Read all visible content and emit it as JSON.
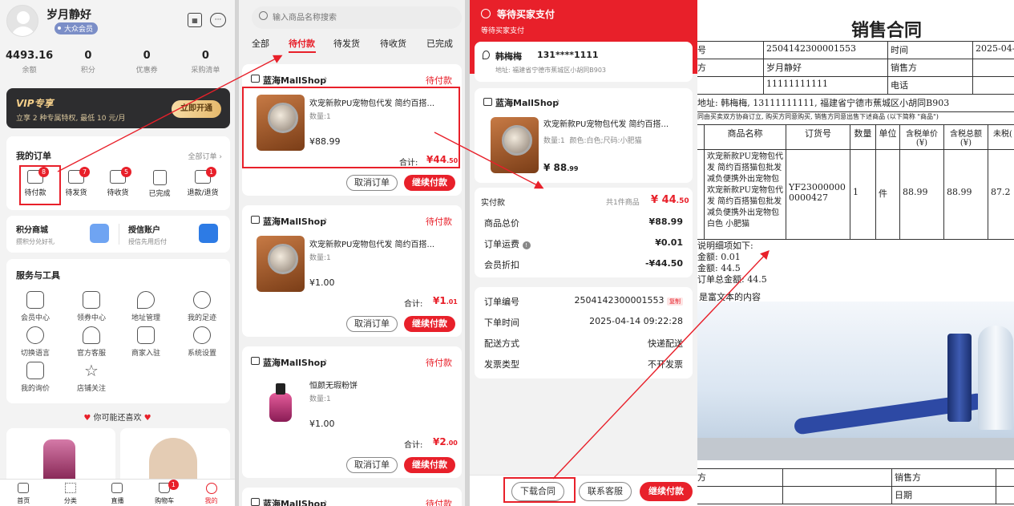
{
  "profile": {
    "name": "岁月静好",
    "member": "大众会员",
    "stats": [
      {
        "value": "4493.16",
        "label": "余额"
      },
      {
        "value": "0",
        "label": "积分"
      },
      {
        "value": "0",
        "label": "优惠券"
      },
      {
        "value": "0",
        "label": "采购清单"
      }
    ]
  },
  "vip": {
    "logo": "VIP专享",
    "desc": "立享 2 种专属特权, 最低 10 元/月",
    "cta": "立即开通"
  },
  "orders": {
    "title": "我的订单",
    "all": "全部订单",
    "items": [
      {
        "label": "待付款",
        "badge": "8"
      },
      {
        "label": "待发货",
        "badge": "7"
      },
      {
        "label": "待收货",
        "badge": "5"
      },
      {
        "label": "已完成",
        "badge": ""
      },
      {
        "label": "退款/退货",
        "badge": "1"
      }
    ]
  },
  "promo": {
    "mall_title": "积分商城",
    "mall_sub": "攒积分兑好礼",
    "credit_title": "授信账户",
    "credit_sub": "授信先用后付"
  },
  "tools": {
    "title": "服务与工具",
    "items": [
      "会员中心",
      "领券中心",
      "地址管理",
      "我的足迹",
      "切换语言",
      "官方客服",
      "商家入驻",
      "系统设置",
      "我的询价",
      "店铺关注"
    ]
  },
  "recommend": "你可能还喜欢",
  "bottom_nav": [
    {
      "label": "首页"
    },
    {
      "label": "分类"
    },
    {
      "label": "直播"
    },
    {
      "label": "购物车",
      "badge": "1"
    },
    {
      "label": "我的"
    }
  ],
  "order_list": {
    "search_placeholder": "输入商品名称搜索",
    "tabs": [
      "全部",
      "待付款",
      "待发货",
      "待收货",
      "已完成"
    ],
    "orders": [
      {
        "shop": "蓝海MallShop",
        "status": "待付款",
        "title": "欢宠新款PU宠物包代发 简约百搭...",
        "qty": "数量:1",
        "price": "¥88.99",
        "total_label": "合计:",
        "total_int": "¥44",
        "total_dec": ".50"
      },
      {
        "shop": "蓝海MallShop",
        "status": "待付款",
        "title": "欢宠新款PU宠物包代发 简约百搭...",
        "qty": "数量:1",
        "price": "¥1.00",
        "total_label": "合计:",
        "total_int": "¥1",
        "total_dec": ".01"
      },
      {
        "shop": "蓝海MallShop",
        "status": "待付款",
        "title": "恒颜无瑕粉饼",
        "qty": "数量:1",
        "price": "¥1.00",
        "total_label": "合计:",
        "total_int": "¥2",
        "total_dec": ".00"
      },
      {
        "shop": "蓝海MallShop",
        "status": "待付款"
      }
    ],
    "cancel": "取消订单",
    "pay": "继续付款"
  },
  "detail": {
    "title": "等待买家支付",
    "sub": "等待买家支付",
    "name": "韩梅梅",
    "phone": "131****1111",
    "address": "地址: 福建省宁德市蕉城区小胡同B903",
    "shop": "蓝海MallShop",
    "product": "欢宠新款PU宠物包代发 简约百搭...",
    "spec": "数量:1  颜色:白色;尺码:小肥猫",
    "price_int": "¥ 88",
    "price_dec": ".99",
    "paid_label": "实付款",
    "paid_count": "共1件商品",
    "paid_int": "¥ 44",
    "paid_dec": ".50",
    "rows": [
      {
        "k": "商品总价",
        "v": "¥88.99"
      },
      {
        "k": "订单运费",
        "v": "¥0.01"
      },
      {
        "k": "会员折扣",
        "v": "-¥44.50"
      }
    ],
    "info": [
      {
        "k": "订单编号",
        "v": "2504142300001553",
        "copy": "复制"
      },
      {
        "k": "下单时间",
        "v": "2025-04-14 09:22:28"
      },
      {
        "k": "配送方式",
        "v": "快递配送"
      },
      {
        "k": "发票类型",
        "v": "不开发票"
      }
    ],
    "btn_download": "下载合同",
    "btn_service": "联系客服",
    "btn_pay": "继续付款"
  },
  "contract": {
    "title": "销售合同",
    "r1": [
      "号",
      "2504142300001553",
      "时间",
      "2025-04-"
    ],
    "r2": [
      "方",
      "岁月静好",
      "销售方",
      ""
    ],
    "r3": [
      "",
      "11111111111",
      "电话",
      ""
    ],
    "addr": "地址: 韩梅梅, 13111111111, 福建省宁德市蕉城区小胡同B903",
    "note": "同由买卖双方协商订立, 购买方同意购买, 销售方同意出售下述商品 (以下简称 \"商品\")",
    "headers": [
      "商品名称",
      "订货号",
      "数量",
      "单位",
      "含税单价(¥)",
      "含税总额(¥)",
      "未税("
    ],
    "item": {
      "name": "欢宠新款PU宠物包代发 简约百搭猫包批发 减负便携外出宠物包欢宠新款PU宠物包代发 简约百搭猫包批发 减负便携外出宠物包 白色 小肥猫",
      "code": "YF230000000000427",
      "qty": "1",
      "unit": "件",
      "price": "88.99",
      "total": "88.99",
      "untax": "87.2"
    },
    "sum_title": "说明细项如下:",
    "sum_lines": [
      "金额: 0.01",
      "金额: 44.5",
      "订单总金额: 44.5"
    ],
    "rich": "是富文本的内容",
    "f1": [
      "方",
      "",
      "销售方",
      ""
    ],
    "f2": [
      "",
      "",
      "日期",
      ""
    ]
  },
  "colors": {
    "accent": "#e8202a"
  }
}
